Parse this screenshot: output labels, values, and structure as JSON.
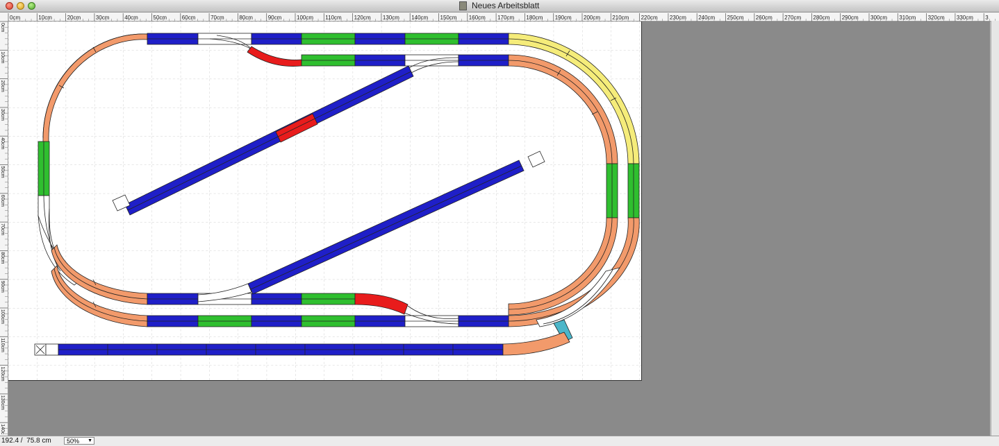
{
  "window": {
    "title": "Neues Arbeitsblatt"
  },
  "ruler": {
    "h_labels": [
      "0cm",
      "10cm",
      "20cm",
      "30cm",
      "40cm",
      "50cm",
      "60cm",
      "70cm",
      "80cm",
      "90cm",
      "100cm",
      "110cm",
      "120cm",
      "130cm",
      "140cm",
      "150cm",
      "160cm",
      "170cm",
      "180cm",
      "190cm",
      "200cm",
      "210cm",
      "220cm",
      "230cm",
      "240cm",
      "250cm",
      "260cm",
      "270cm",
      "280cm",
      "290cm",
      "300cm",
      "310cm",
      "320cm",
      "330cm",
      "3"
    ],
    "v_labels": [
      "0cm",
      "10cm",
      "20cm",
      "30cm",
      "40cm",
      "50cm",
      "60cm",
      "70cm",
      "80cm",
      "90cm",
      "100cm",
      "110cm",
      "120cm",
      "130cm",
      "140c"
    ]
  },
  "status": {
    "coordinates": "192.4 /  75.8 cm",
    "zoom": "50%"
  },
  "colors": {
    "straight_blue": "#1f1fc8",
    "straight_green": "#2fbf2f",
    "curve_orange": "#f29a6b",
    "curve_yellow": "#f5ec7a",
    "short_red": "#e81c1c",
    "short_cyan": "#4bb6c9",
    "switch": "#ffffff",
    "workspace_gray": "#8a8a8a"
  }
}
